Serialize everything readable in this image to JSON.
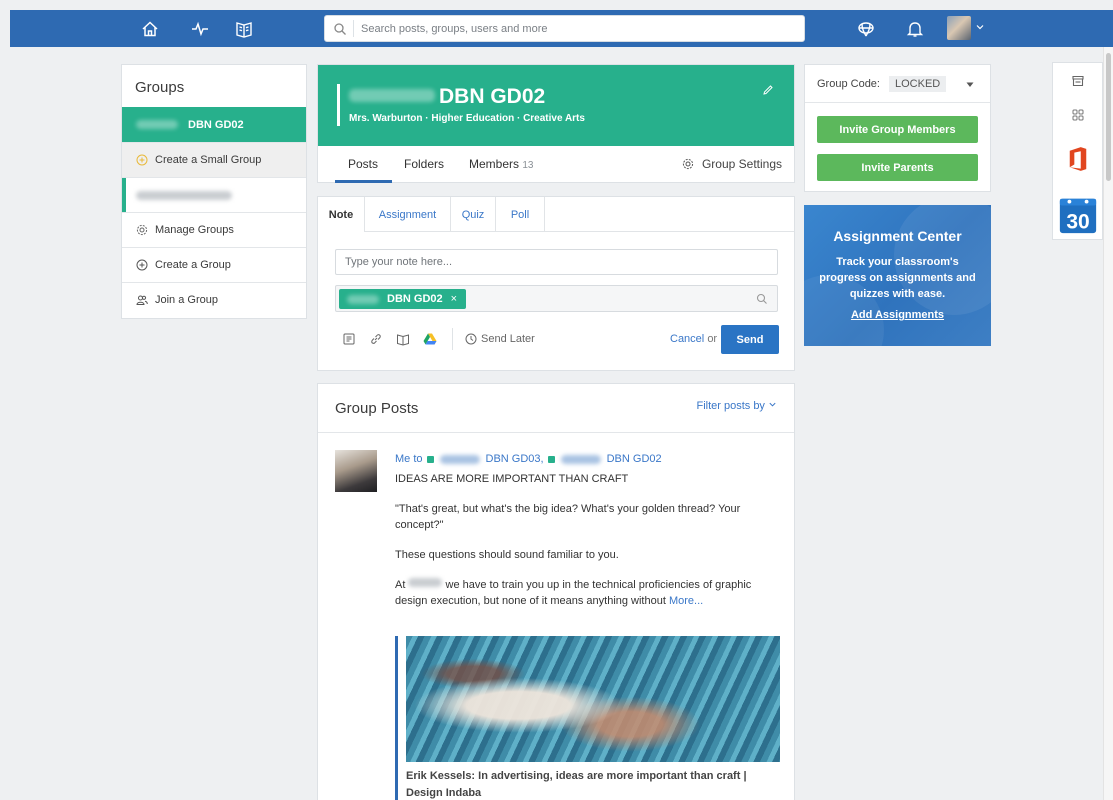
{
  "search": {
    "placeholder": "Search posts, groups, users and more"
  },
  "sidebar": {
    "title": "Groups",
    "active_group": "DBN GD02",
    "items": [
      {
        "label": "Create a Small Group"
      },
      {
        "label": "Manage Groups"
      },
      {
        "label": "Create a Group"
      },
      {
        "label": "Join a Group"
      }
    ]
  },
  "group": {
    "name": "DBN GD02",
    "subtitle": "Mrs. Warburton · Higher Education · Creative Arts",
    "tabs": [
      {
        "label": "Posts"
      },
      {
        "label": "Folders"
      },
      {
        "label": "Members",
        "count": "13"
      }
    ],
    "settings_label": "Group Settings"
  },
  "composer": {
    "tabs": [
      "Note",
      "Assignment",
      "Quiz",
      "Poll"
    ],
    "note_placeholder": "Type your note here...",
    "recipient_chip": "DBN GD02",
    "chip_remove": "×",
    "send_later": "Send Later",
    "cancel": "Cancel",
    "or": "or",
    "send": "Send"
  },
  "posts": {
    "title": "Group Posts",
    "filter": "Filter posts by",
    "post": {
      "author": "Me",
      "to": "to",
      "recipient1": "DBN GD03,",
      "recipient2": "DBN GD02",
      "headline": "IDEAS ARE MORE IMPORTANT THAN CRAFT",
      "p1": "\"That's great, but what's the big idea? What's your golden thread? Your concept?\"",
      "p2": "These questions should sound familiar to you.",
      "p3_start": "At",
      "p3_rest": "we have to train you up in the technical proficiencies of graphic design execution, but none of it means anything without",
      "more": "More...",
      "attachment_title": "Erik Kessels: In advertising, ideas are more important than craft | Design Indaba"
    }
  },
  "group_code": {
    "label": "Group Code:",
    "value": "LOCKED",
    "invite_members": "Invite Group Members",
    "invite_parents": "Invite Parents"
  },
  "assignment_center": {
    "title": "Assignment Center",
    "description": "Track your classroom's progress on assignments and quizzes with ease.",
    "link": "Add Assignments"
  },
  "apps": {
    "calendar_day": "30"
  },
  "colors": {
    "brand_blue": "#2e6ab2",
    "group_green": "#27b08c",
    "button_green": "#5cb85c",
    "send_blue": "#2a74c4",
    "office_red": "#e1461f"
  }
}
